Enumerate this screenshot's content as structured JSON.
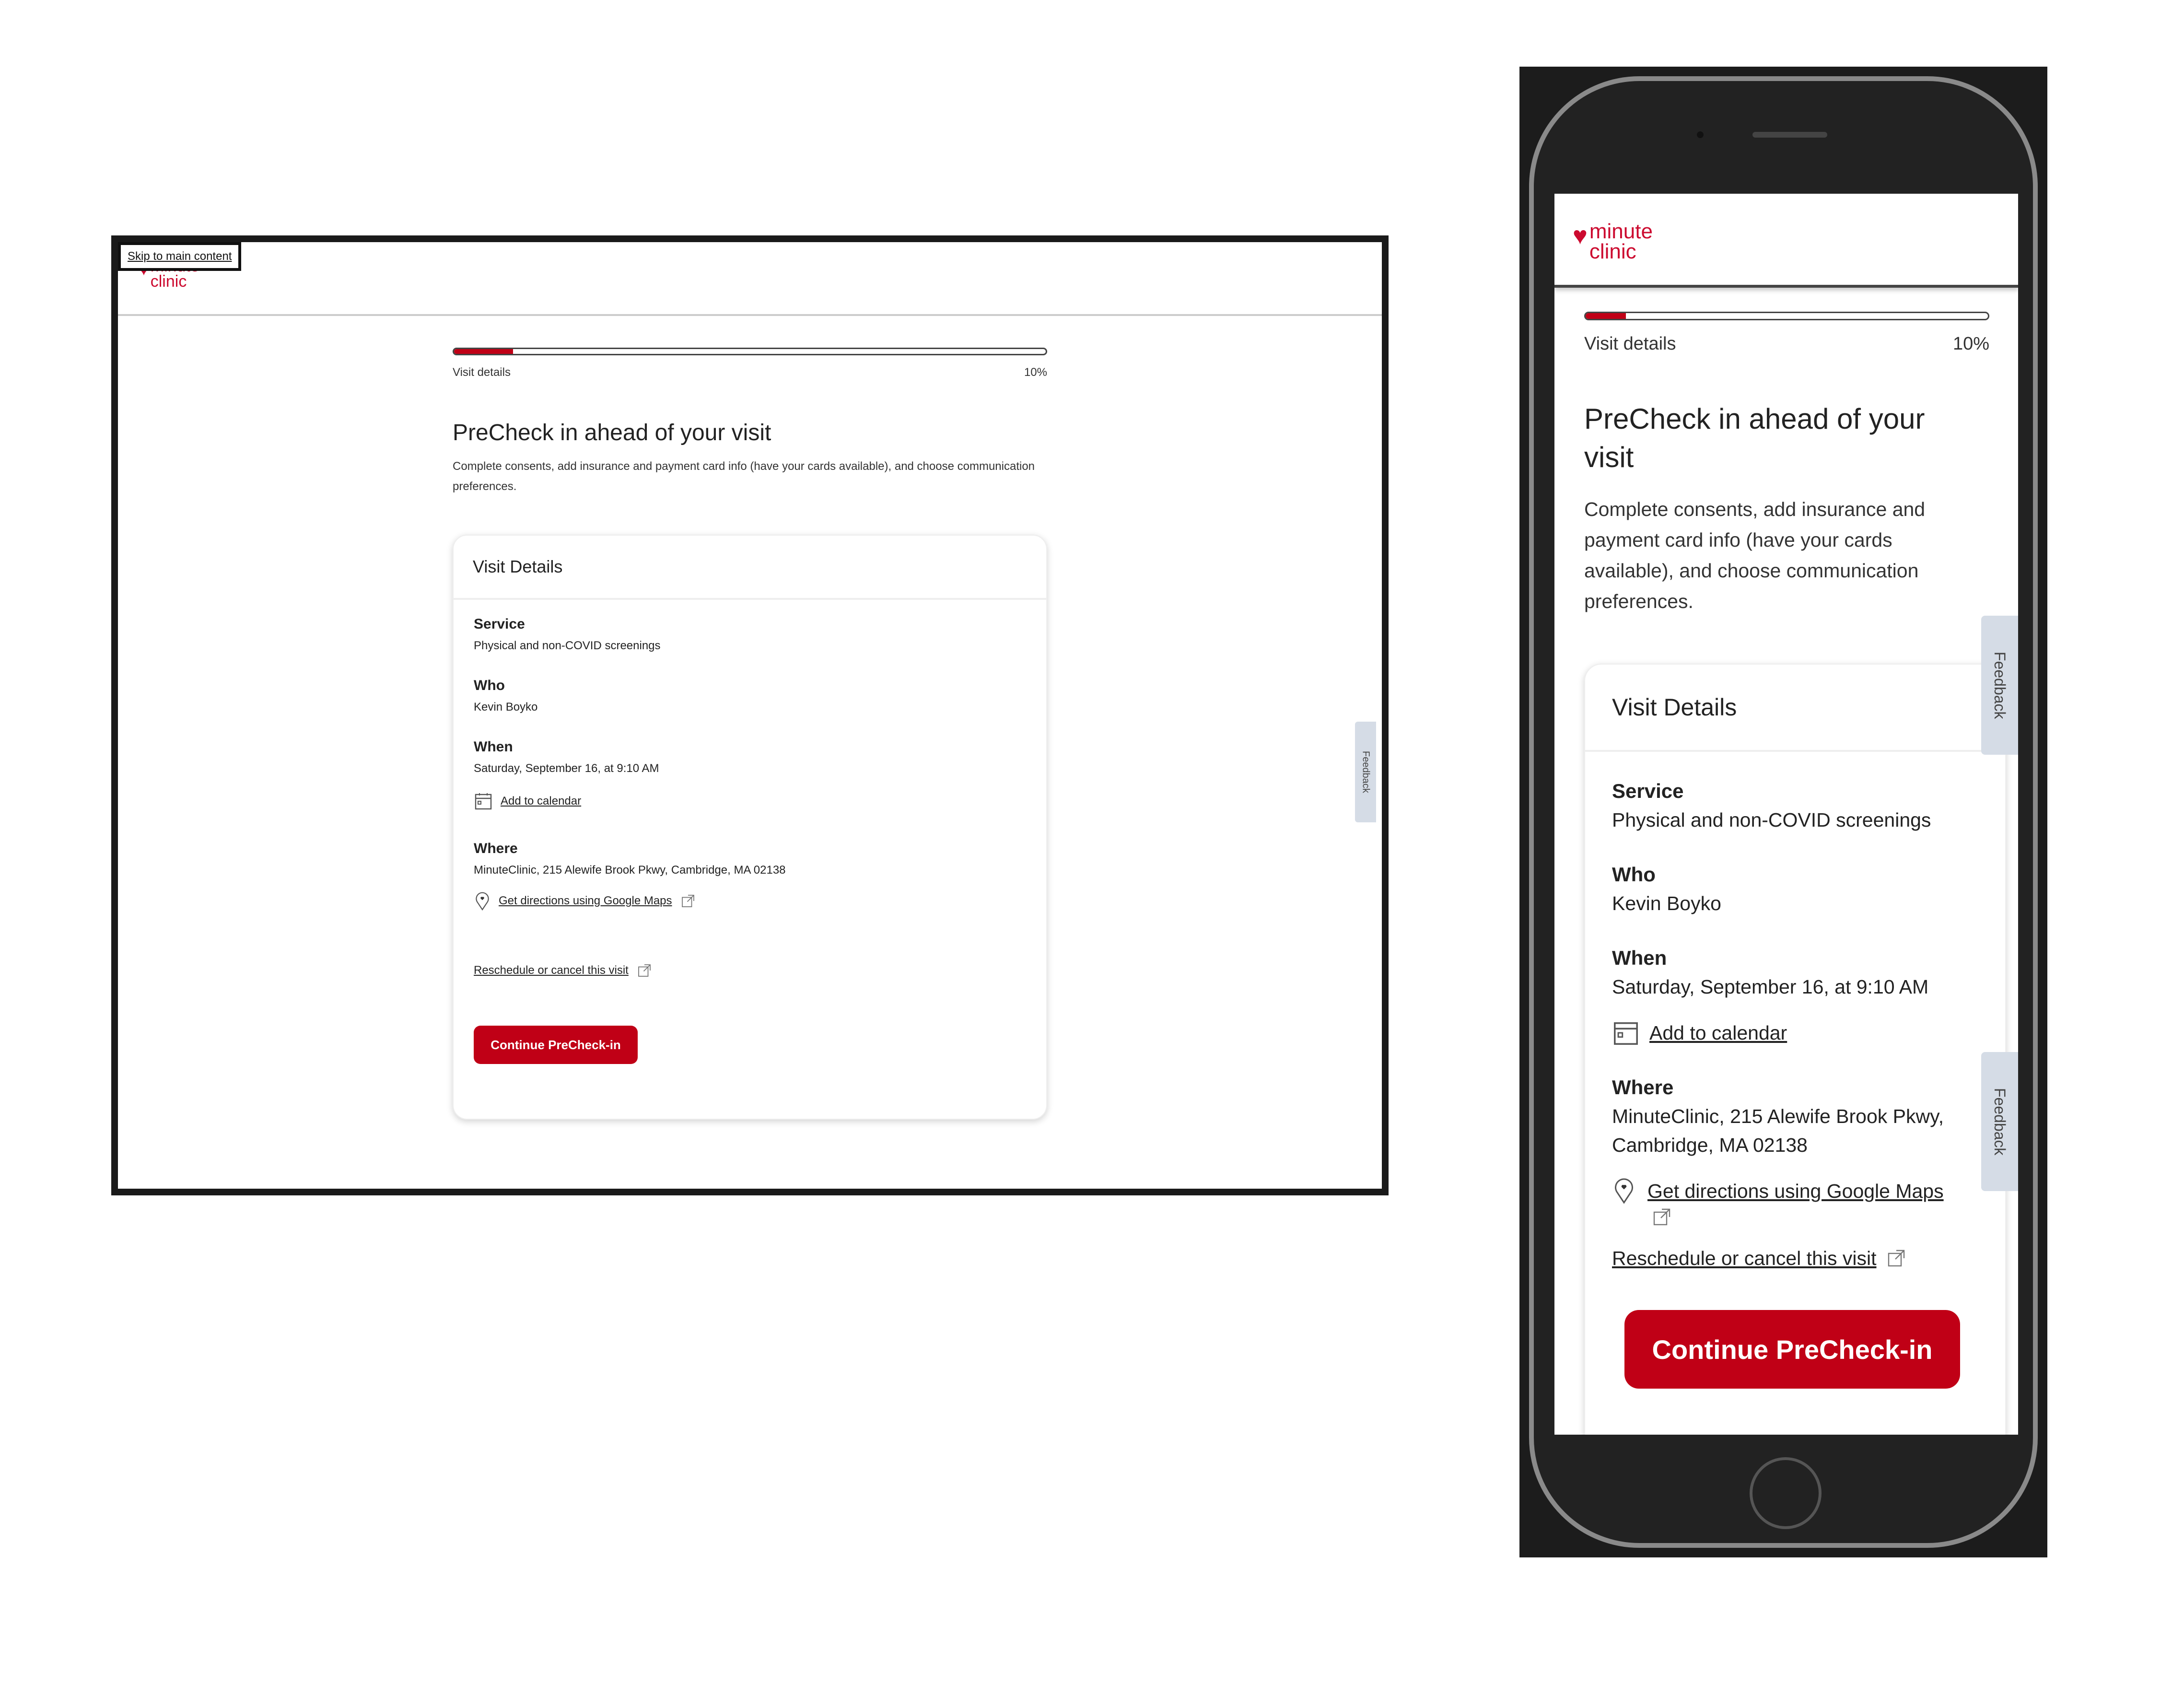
{
  "brand": {
    "line1": "minute",
    "line2": "clinic",
    "mark": "®",
    "color": "#cc0a2f"
  },
  "skip_link": "Skip to main content",
  "progress": {
    "label": "Visit details",
    "percent_text": "10%",
    "value": 0.1,
    "fill_color": "#c00016"
  },
  "page": {
    "title": "PreCheck in ahead of your visit",
    "intro": "Complete consents, add insurance and payment card info (have your cards available), and choose communication preferences."
  },
  "card": {
    "title": "Visit Details",
    "service_label": "Service",
    "service_value": "Physical and non-COVID screenings",
    "who_label": "Who",
    "who_value": "Kevin Boyko",
    "when_label": "When",
    "when_value": "Saturday, September 16, at 9:10 AM",
    "add_calendar": "Add to calendar",
    "where_label": "Where",
    "where_value": "MinuteClinic, 215 Alewife Brook Pkwy, Cambridge, MA 02138",
    "directions": "Get directions using Google Maps",
    "reschedule": "Reschedule or cancel this visit",
    "continue_button": "Continue PreCheck-in"
  },
  "feedback_tab": "Feedback",
  "icons": {
    "heart": "♥",
    "calendar": "calendar-icon",
    "pin": "map-pin-icon",
    "external": "external-link-icon"
  }
}
